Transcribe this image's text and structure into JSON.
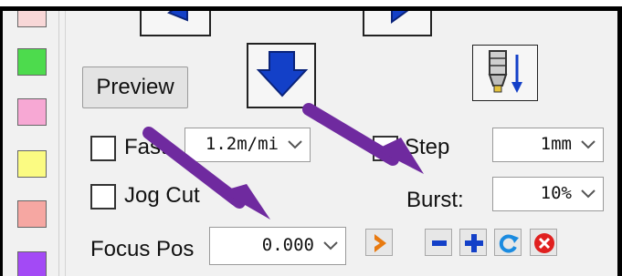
{
  "swatches": [
    "#f8d7d7",
    "#4ddb4d",
    "#f7a8d4",
    "#fbfb82",
    "#f6a7a2",
    "#a34af5"
  ],
  "buttons": {
    "preview_label": "Preview"
  },
  "fast": {
    "label": "Fast",
    "speed": "1.2m/mi"
  },
  "step": {
    "label": "Step",
    "value": "1mm"
  },
  "jog_cut": {
    "label": "Jog Cut"
  },
  "burst": {
    "label": "Burst:",
    "value": "10%"
  },
  "focus_pos": {
    "label": "Focus Pos",
    "value": "0.000"
  },
  "icons": {
    "nav_left": "blue-left-arrow-icon",
    "nav_right": "blue-right-arrow-icon",
    "move_down": "blue-down-arrow-icon",
    "laser_head": "laser-head-down-icon",
    "start": "orange-chevron-icon",
    "minus": "blue-minus-icon",
    "plus": "blue-plus-icon",
    "refresh": "blue-refresh-icon",
    "cancel": "red-x-icon",
    "annotation": "purple-arrow-icon"
  },
  "colors": {
    "accent_blue": "#1340c8",
    "annotation_purple": "#6f2a9f",
    "cancel_red": "#e0201f",
    "start_orange": "#e87a10"
  }
}
